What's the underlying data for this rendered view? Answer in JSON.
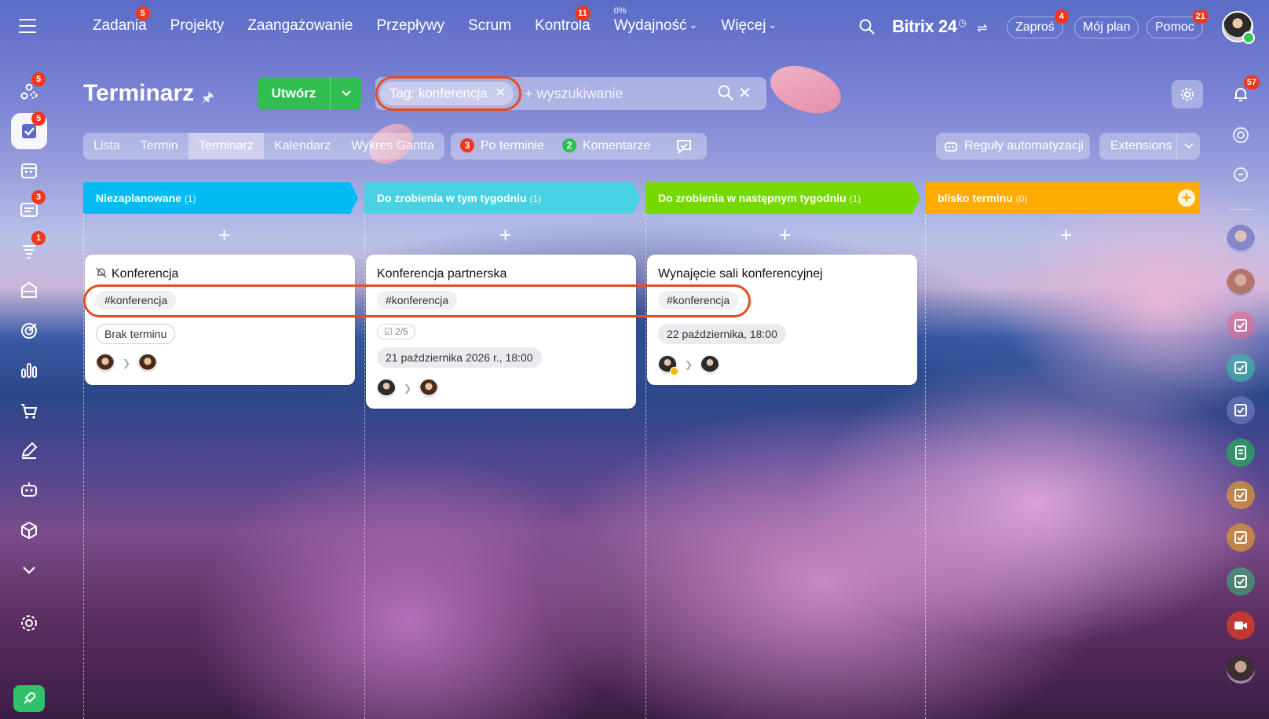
{
  "topnav": {
    "items": [
      {
        "label": "Zadania",
        "badge": "5"
      },
      {
        "label": "Projekty"
      },
      {
        "label": "Zaangażowanie"
      },
      {
        "label": "Przepływy"
      },
      {
        "label": "Scrum"
      },
      {
        "label": "Kontrola",
        "badge": "11"
      },
      {
        "label": "Wydajność",
        "percent": "0%"
      },
      {
        "label": "Więcej"
      }
    ],
    "brand": "Bitrix",
    "brand_num": "24",
    "invite": {
      "label": "Zaproś",
      "badge": "4"
    },
    "plan": "Mój plan",
    "help": {
      "label": "Pomoc",
      "badge": "21"
    }
  },
  "sidebar": {
    "badges": {
      "feed": "5",
      "tasks": "5",
      "messenger": "3",
      "flows": "1"
    }
  },
  "rightbar": {
    "notifications_badge": "57"
  },
  "header": {
    "title": "Terminarz",
    "create_label": "Utwórz",
    "tag_chip": "Tag: konferencja",
    "search_placeholder": "+ wyszukiwanie"
  },
  "views": [
    "Lista",
    "Termin",
    "Terminarz",
    "Kalendarz",
    "Wykres Gantta"
  ],
  "active_view": "Terminarz",
  "counters": {
    "overdue": {
      "num": "3",
      "label": "Po terminie"
    },
    "comments": {
      "num": "2",
      "label": "Komentarze"
    }
  },
  "toolbar": {
    "automation": "Reguły automatyzacji",
    "extensions": "Extensions"
  },
  "columns": [
    {
      "title": "Niezaplanowane",
      "count": "(1)",
      "color": "#00bcf2"
    },
    {
      "title": "Do zrobienia w tym tygodniu",
      "count": "(1)",
      "color": "#47d1e2"
    },
    {
      "title": "Do zrobienia w następnym tygodniu",
      "count": "(1)",
      "color": "#75d900"
    },
    {
      "title": "blisko terminu",
      "count": "(0)",
      "color": "#ffab00"
    }
  ],
  "cards": [
    {
      "title": "Konferencja",
      "tag": "#konferencja",
      "deadline": "Brak terminu"
    },
    {
      "title": "Konferencja partnerska",
      "tag": "#konferencja",
      "checklist": "2/5",
      "deadline": "21 października 2026 r., 18:00"
    },
    {
      "title": "Wynajęcie sali konferencyjnej",
      "tag": "#konferencja",
      "deadline": "22 października, 18:00"
    }
  ]
}
